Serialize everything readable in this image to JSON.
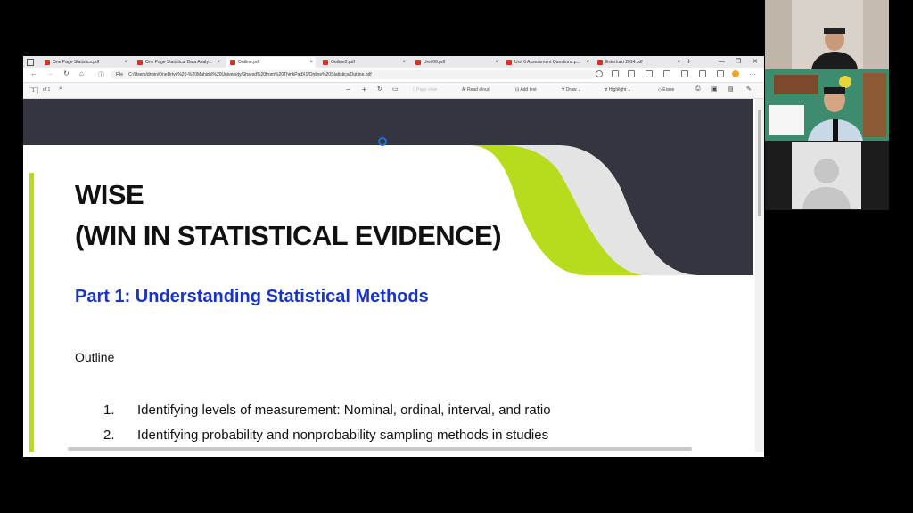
{
  "browser": {
    "tabs": [
      {
        "label": "One Page Statistics.pdf",
        "active": false
      },
      {
        "label": "One Page Statistical Data Analy...",
        "active": false
      },
      {
        "label": "Outline.pdf",
        "active": true
      },
      {
        "label": "Outline2.pdf",
        "active": false
      },
      {
        "label": "Unit 06.pdf",
        "active": false
      },
      {
        "label": "Unit 6 Assessment Questions.p...",
        "active": false
      },
      {
        "label": "Esterhazi 2014.pdf",
        "active": false
      }
    ],
    "new_tab": "+",
    "window_controls": [
      "—",
      "❐",
      "✕"
    ],
    "address_scheme": "File",
    "address": "C:/Users/drwin/OneDrive%20-%20Mahidol%20University/Shared%20from%20ThinkPadX1/Online%20Statistics/Outline.pdf"
  },
  "pdf_toolbar": {
    "page_current": "1",
    "page_total": "of 1",
    "page_view": "Page view",
    "read_aloud": "Read aloud",
    "add_text": "Add text",
    "draw": "Draw",
    "highlight": "Highlight",
    "erase": "Erase"
  },
  "document": {
    "title_line1": "WISE",
    "title_line2": "(WIN IN STATISTICAL EVIDENCE)",
    "part": "Part 1: Understanding Statistical Methods",
    "outline_heading": "Outline",
    "items": [
      {
        "num": "1.",
        "text": "Identifying levels of measurement: Nominal, ordinal, interval, and ratio"
      },
      {
        "num": "2.",
        "text": "Identifying probability and nonprobability sampling methods in studies"
      }
    ]
  },
  "colors": {
    "banner_dark": "#33363f",
    "accent_green": "#b7dc1c",
    "swoosh_gray": "#e4e4e4",
    "part_blue": "#1a33c9"
  },
  "video_panels": [
    "participant-camera",
    "presenter-camera",
    "placeholder-avatar"
  ]
}
